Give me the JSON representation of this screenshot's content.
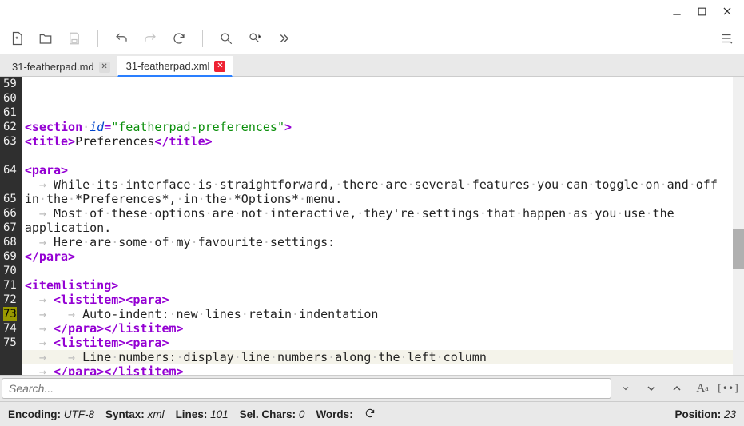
{
  "window": {
    "minimize": "—",
    "maximize": "▢",
    "close": "✕"
  },
  "tabs": [
    {
      "label": "31-featherpad.md",
      "active": false,
      "modified": false
    },
    {
      "label": "31-featherpad.xml",
      "active": true,
      "modified": true
    }
  ],
  "gutter_start": 59,
  "current_line": 73,
  "code_lines": [
    {
      "n": 59,
      "segs": [
        {
          "c": "tag",
          "t": "<section"
        },
        {
          "c": "ws",
          "t": "·"
        },
        {
          "c": "attr",
          "t": "id"
        },
        {
          "c": "tag",
          "t": "="
        },
        {
          "c": "str",
          "t": "\"featherpad-preferences\""
        },
        {
          "c": "tag",
          "t": ">"
        }
      ]
    },
    {
      "n": 60,
      "segs": [
        {
          "c": "tag",
          "t": "<title>"
        },
        {
          "c": "txt",
          "t": "Preferences"
        },
        {
          "c": "tag",
          "t": "</title>"
        }
      ]
    },
    {
      "n": 61,
      "segs": []
    },
    {
      "n": 62,
      "segs": [
        {
          "c": "tag",
          "t": "<para>"
        }
      ]
    },
    {
      "n": 63,
      "segs": [
        {
          "c": "ws",
          "t": "  → "
        },
        {
          "c": "txt",
          "t": "While"
        },
        {
          "c": "ws",
          "t": "·"
        },
        {
          "c": "txt",
          "t": "its"
        },
        {
          "c": "ws",
          "t": "·"
        },
        {
          "c": "txt",
          "t": "interface"
        },
        {
          "c": "ws",
          "t": "·"
        },
        {
          "c": "txt",
          "t": "is"
        },
        {
          "c": "ws",
          "t": "·"
        },
        {
          "c": "txt",
          "t": "straightforward,"
        },
        {
          "c": "ws",
          "t": "·"
        },
        {
          "c": "txt",
          "t": "there"
        },
        {
          "c": "ws",
          "t": "·"
        },
        {
          "c": "txt",
          "t": "are"
        },
        {
          "c": "ws",
          "t": "·"
        },
        {
          "c": "txt",
          "t": "several"
        },
        {
          "c": "ws",
          "t": "·"
        },
        {
          "c": "txt",
          "t": "features"
        },
        {
          "c": "ws",
          "t": "·"
        },
        {
          "c": "txt",
          "t": "you"
        },
        {
          "c": "ws",
          "t": "·"
        },
        {
          "c": "txt",
          "t": "can"
        },
        {
          "c": "ws",
          "t": "·"
        },
        {
          "c": "txt",
          "t": "toggle"
        },
        {
          "c": "ws",
          "t": "·"
        },
        {
          "c": "txt",
          "t": "on"
        },
        {
          "c": "ws",
          "t": "·"
        },
        {
          "c": "txt",
          "t": "and"
        },
        {
          "c": "ws",
          "t": "·"
        },
        {
          "c": "txt",
          "t": "off"
        }
      ]
    },
    {
      "n": -1,
      "wrap_of": 63,
      "segs": [
        {
          "c": "txt",
          "t": "in"
        },
        {
          "c": "ws",
          "t": "·"
        },
        {
          "c": "txt",
          "t": "the"
        },
        {
          "c": "ws",
          "t": "·"
        },
        {
          "c": "txt",
          "t": "*Preferences*,"
        },
        {
          "c": "ws",
          "t": "·"
        },
        {
          "c": "txt",
          "t": "in"
        },
        {
          "c": "ws",
          "t": "·"
        },
        {
          "c": "txt",
          "t": "the"
        },
        {
          "c": "ws",
          "t": "·"
        },
        {
          "c": "txt",
          "t": "*Options*"
        },
        {
          "c": "ws",
          "t": "·"
        },
        {
          "c": "txt",
          "t": "menu."
        }
      ]
    },
    {
      "n": 64,
      "segs": [
        {
          "c": "ws",
          "t": "  → "
        },
        {
          "c": "txt",
          "t": "Most"
        },
        {
          "c": "ws",
          "t": "·"
        },
        {
          "c": "txt",
          "t": "of"
        },
        {
          "c": "ws",
          "t": "·"
        },
        {
          "c": "txt",
          "t": "these"
        },
        {
          "c": "ws",
          "t": "·"
        },
        {
          "c": "txt",
          "t": "options"
        },
        {
          "c": "ws",
          "t": "·"
        },
        {
          "c": "txt",
          "t": "are"
        },
        {
          "c": "ws",
          "t": "·"
        },
        {
          "c": "txt",
          "t": "not"
        },
        {
          "c": "ws",
          "t": "·"
        },
        {
          "c": "txt",
          "t": "interactive,"
        },
        {
          "c": "ws",
          "t": "·"
        },
        {
          "c": "txt",
          "t": "they're"
        },
        {
          "c": "ws",
          "t": "·"
        },
        {
          "c": "txt",
          "t": "settings"
        },
        {
          "c": "ws",
          "t": "·"
        },
        {
          "c": "txt",
          "t": "that"
        },
        {
          "c": "ws",
          "t": "·"
        },
        {
          "c": "txt",
          "t": "happen"
        },
        {
          "c": "ws",
          "t": "·"
        },
        {
          "c": "txt",
          "t": "as"
        },
        {
          "c": "ws",
          "t": "·"
        },
        {
          "c": "txt",
          "t": "you"
        },
        {
          "c": "ws",
          "t": "·"
        },
        {
          "c": "txt",
          "t": "use"
        },
        {
          "c": "ws",
          "t": "·"
        },
        {
          "c": "txt",
          "t": "the"
        }
      ]
    },
    {
      "n": -1,
      "wrap_of": 64,
      "segs": [
        {
          "c": "txt",
          "t": "application."
        }
      ]
    },
    {
      "n": 65,
      "segs": [
        {
          "c": "ws",
          "t": "  → "
        },
        {
          "c": "txt",
          "t": "Here"
        },
        {
          "c": "ws",
          "t": "·"
        },
        {
          "c": "txt",
          "t": "are"
        },
        {
          "c": "ws",
          "t": "·"
        },
        {
          "c": "txt",
          "t": "some"
        },
        {
          "c": "ws",
          "t": "·"
        },
        {
          "c": "txt",
          "t": "of"
        },
        {
          "c": "ws",
          "t": "·"
        },
        {
          "c": "txt",
          "t": "my"
        },
        {
          "c": "ws",
          "t": "·"
        },
        {
          "c": "txt",
          "t": "favourite"
        },
        {
          "c": "ws",
          "t": "·"
        },
        {
          "c": "txt",
          "t": "settings:"
        }
      ]
    },
    {
      "n": 66,
      "segs": [
        {
          "c": "tag",
          "t": "</para>"
        }
      ]
    },
    {
      "n": 67,
      "segs": []
    },
    {
      "n": 68,
      "segs": [
        {
          "c": "tag",
          "t": "<itemlisting>"
        }
      ]
    },
    {
      "n": 69,
      "segs": [
        {
          "c": "ws",
          "t": "  → "
        },
        {
          "c": "tag",
          "t": "<listitem><para>"
        }
      ]
    },
    {
      "n": 70,
      "segs": [
        {
          "c": "ws",
          "t": "  →   → "
        },
        {
          "c": "txt",
          "t": "Auto-indent:"
        },
        {
          "c": "ws",
          "t": "·"
        },
        {
          "c": "txt",
          "t": "new"
        },
        {
          "c": "ws",
          "t": "·"
        },
        {
          "c": "txt",
          "t": "lines"
        },
        {
          "c": "ws",
          "t": "·"
        },
        {
          "c": "txt",
          "t": "retain"
        },
        {
          "c": "ws",
          "t": "·"
        },
        {
          "c": "txt",
          "t": "indentation"
        }
      ]
    },
    {
      "n": 71,
      "segs": [
        {
          "c": "ws",
          "t": "  → "
        },
        {
          "c": "tag",
          "t": "</para></listitem>"
        }
      ]
    },
    {
      "n": 72,
      "segs": [
        {
          "c": "ws",
          "t": "  → "
        },
        {
          "c": "tag",
          "t": "<listitem><para>"
        }
      ]
    },
    {
      "n": 73,
      "segs": [
        {
          "c": "ws",
          "t": "  →   → "
        },
        {
          "c": "txt",
          "t": "Line"
        },
        {
          "c": "ws",
          "t": "·"
        },
        {
          "c": "txt",
          "t": "numbers:"
        },
        {
          "c": "ws",
          "t": "·"
        },
        {
          "c": "txt",
          "t": "display"
        },
        {
          "c": "ws",
          "t": "·"
        },
        {
          "c": "txt",
          "t": "line"
        },
        {
          "c": "ws",
          "t": "·"
        },
        {
          "c": "txt",
          "t": "numbers"
        },
        {
          "c": "ws",
          "t": "·"
        },
        {
          "c": "txt",
          "t": "along"
        },
        {
          "c": "ws",
          "t": "·"
        },
        {
          "c": "txt",
          "t": "the"
        },
        {
          "c": "ws",
          "t": "·"
        },
        {
          "c": "txt",
          "t": "left"
        },
        {
          "c": "ws",
          "t": "·"
        },
        {
          "c": "txt",
          "t": "column"
        }
      ]
    },
    {
      "n": 74,
      "segs": [
        {
          "c": "ws",
          "t": "  → "
        },
        {
          "c": "tag",
          "t": "</para></listitem>"
        }
      ]
    },
    {
      "n": 75,
      "segs": [
        {
          "c": "ws",
          "t": "  → "
        },
        {
          "c": "tag",
          "t": "<listitem><para>"
        }
      ]
    }
  ],
  "search": {
    "placeholder": "Search..."
  },
  "status": {
    "encoding_label": "Encoding:",
    "encoding": "UTF-8",
    "syntax_label": "Syntax:",
    "syntax": "xml",
    "lines_label": "Lines:",
    "lines": "101",
    "sel_label": "Sel. Chars:",
    "sel": "0",
    "words_label": "Words:",
    "position_label": "Position:",
    "position": "23"
  }
}
